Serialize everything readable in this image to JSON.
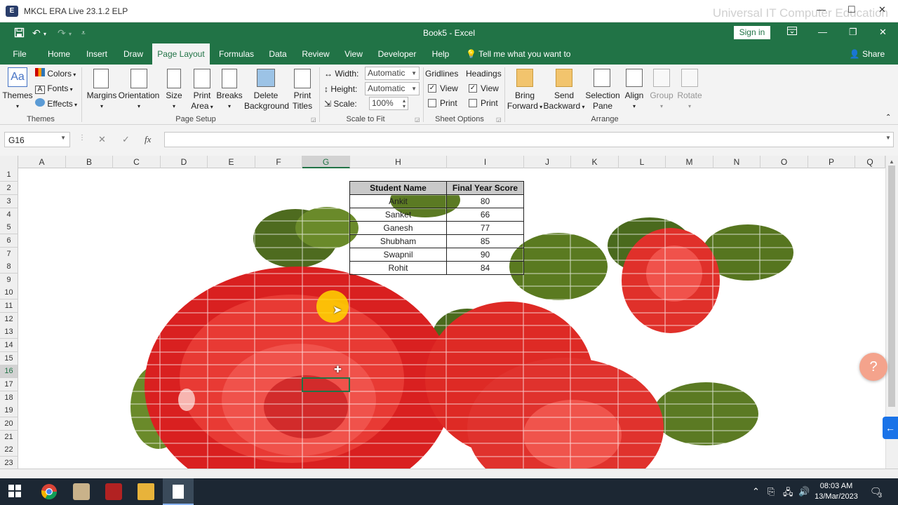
{
  "outer_window": {
    "title": "MKCL ERA Live 23.1.2 ELP",
    "watermark": "Universal IT Computer Education"
  },
  "title_bar": {
    "document_title": "Book5  -  Excel",
    "sign_in": "Sign in"
  },
  "tabs": [
    "File",
    "Home",
    "Insert",
    "Draw",
    "Page Layout",
    "Formulas",
    "Data",
    "Review",
    "View",
    "Developer",
    "Help"
  ],
  "active_tab": "Page Layout",
  "tell_me": "Tell me what you want to do",
  "share": "Share",
  "ribbon": {
    "themes": {
      "themes_label": "Themes",
      "colors": "Colors",
      "fonts": "Fonts",
      "effects": "Effects",
      "group_label": "Themes"
    },
    "page_setup": {
      "margins": "Margins",
      "orientation": "Orientation",
      "size": "Size",
      "print_area_1": "Print",
      "print_area_2": "Area",
      "breaks": "Breaks",
      "delete_bg_1": "Delete",
      "delete_bg_2": "Background",
      "print_titles_1": "Print",
      "print_titles_2": "Titles",
      "group_label": "Page Setup"
    },
    "scale_to_fit": {
      "width_label": "Width:",
      "width_value": "Automatic",
      "height_label": "Height:",
      "height_value": "Automatic",
      "scale_label": "Scale:",
      "scale_value": "100%",
      "group_label": "Scale to Fit"
    },
    "sheet_options": {
      "gridlines": "Gridlines",
      "headings": "Headings",
      "view": "View",
      "print": "Print",
      "group_label": "Sheet Options"
    },
    "arrange": {
      "bring_forward_1": "Bring",
      "bring_forward_2": "Forward",
      "send_backward_1": "Send",
      "send_backward_2": "Backward",
      "selection_pane_1": "Selection",
      "selection_pane_2": "Pane",
      "align": "Align",
      "group": "Group",
      "rotate": "Rotate",
      "group_label": "Arrange"
    }
  },
  "formula_bar": {
    "name_box": "G16",
    "fx": "fx",
    "cancel": "✕",
    "enter": "✓",
    "value": ""
  },
  "columns": [
    "A",
    "B",
    "C",
    "D",
    "E",
    "F",
    "G",
    "H",
    "I",
    "J",
    "K",
    "L",
    "M",
    "N",
    "O",
    "P",
    "Q"
  ],
  "rows": [
    "1",
    "2",
    "3",
    "4",
    "5",
    "6",
    "7",
    "8",
    "9",
    "10",
    "11",
    "12",
    "13",
    "14",
    "15",
    "16",
    "17",
    "18",
    "19",
    "20",
    "21",
    "22",
    "23"
  ],
  "selected_cell": "G16",
  "table": {
    "headers": [
      "Student Name",
      "Final Year Score"
    ],
    "rows": [
      [
        "Ankit",
        "80"
      ],
      [
        "Sanket",
        "66"
      ],
      [
        "Ganesh",
        "77"
      ],
      [
        "Shubham",
        "85"
      ],
      [
        "Swapnil",
        "90"
      ],
      [
        "Rohit",
        "84"
      ]
    ]
  },
  "taskbar": {
    "time": "08:03 AM",
    "date": "13/Mar/2023",
    "notifications": "3"
  },
  "colors": {
    "excel_green": "#217346",
    "taskbar": "#1c2733",
    "table_header": "#c9c9c9"
  }
}
